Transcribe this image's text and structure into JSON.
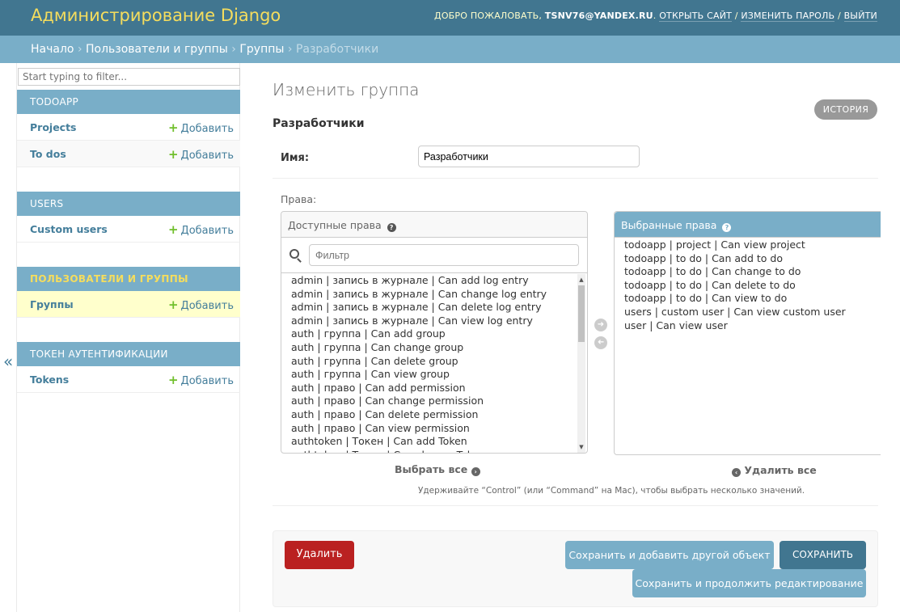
{
  "header": {
    "site_name": "Администрирование Django",
    "welcome": "Добро пожаловать,",
    "username": "tsnv76@yandex.ru",
    "view_site": "Открыть сайт",
    "change_password": "Изменить пароль",
    "logout": "Выйти",
    "separator": "/"
  },
  "breadcrumbs": {
    "home": "Начало",
    "app": "Пользователи и группы",
    "model": "Группы",
    "current": "Разработчики",
    "separator": "›"
  },
  "sidebar": {
    "filter_placeholder": "Start typing to filter...",
    "add_label": "Добавить",
    "toggle": "«",
    "apps": [
      {
        "name": "TODOAPP",
        "models": [
          "Projects",
          "To dos"
        ]
      },
      {
        "name": "USERS",
        "models": [
          "Custom users"
        ]
      },
      {
        "name": "Пользователи и группы",
        "models": [
          "Группы"
        ]
      },
      {
        "name": "Токен аутентификации",
        "models": [
          "Tokens"
        ]
      }
    ]
  },
  "page": {
    "title": "Изменить группа",
    "history": "История",
    "object_title": "Разработчики",
    "name_label": "Имя:",
    "name_value": "Разработчики",
    "permissions_label": "Права:"
  },
  "selector": {
    "available_title": "Доступные права",
    "chosen_title": "Выбранные права",
    "filter_placeholder": "Фильтр",
    "available": [
      "admin | запись в журнале | Can add log entry",
      "admin | запись в журнале | Can change log entry",
      "admin | запись в журнале | Can delete log entry",
      "admin | запись в журнале | Can view log entry",
      "auth | группа | Can add group",
      "auth | группа | Can change group",
      "auth | группа | Can delete group",
      "auth | группа | Can view group",
      "auth | право | Can add permission",
      "auth | право | Can change permission",
      "auth | право | Can delete permission",
      "auth | право | Can view permission",
      "authtoken | Токен | Can add Token",
      "authtoken | Токен | Can change Token"
    ],
    "chosen": [
      "todoapp | project | Can view project",
      "todoapp | to do | Can add to do",
      "todoapp | to do | Can change to do",
      "todoapp | to do | Can delete to do",
      "todoapp | to do | Can view to do",
      "users | custom user | Can view custom user",
      "user | Can view user"
    ],
    "choose_all": "Выбрать все",
    "remove_all": "Удалить все",
    "help": "Удерживайте “Control” (или “Command” на Mac), чтобы выбрать несколько значений."
  },
  "submit": {
    "delete": "Удалить",
    "save_add": "Сохранить и добавить другой объект",
    "save": "Сохранить",
    "save_continue": "Сохранить и продолжить редактирование"
  }
}
